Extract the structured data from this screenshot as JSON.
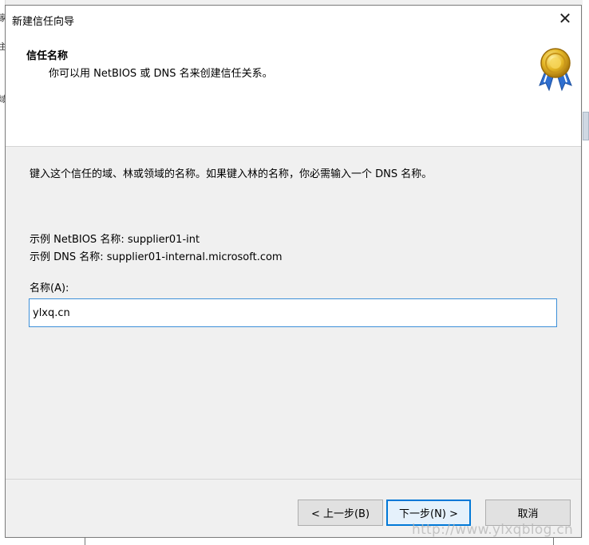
{
  "dialog": {
    "title": "新建信任向导",
    "close_glyph": "✕"
  },
  "header": {
    "title": "信任名称",
    "subtitle": "你可以用 NetBIOS 或 DNS 名来创建信任关系。",
    "icon": "award-medal-icon"
  },
  "main": {
    "instruction": "键入这个信任的域、林或领域的名称。如果键入林的名称，你必需输入一个 DNS 名称。",
    "example_netbios": "示例 NetBIOS 名称: supplier01-int",
    "example_dns": "示例 DNS 名称: supplier01-internal.microsoft.com",
    "name_label": "名称(A):",
    "name_value": "ylxq.cn"
  },
  "buttons": {
    "back": "< 上一步(B)",
    "next": "下一步(N) >",
    "cancel": "取消"
  },
  "background": {
    "left_fragments": [
      "家",
      "主",
      "域"
    ]
  },
  "watermark": "http://www.ylxqblog.cn",
  "colors": {
    "accent": "#0078d7",
    "input_border": "#3d8fd8"
  }
}
